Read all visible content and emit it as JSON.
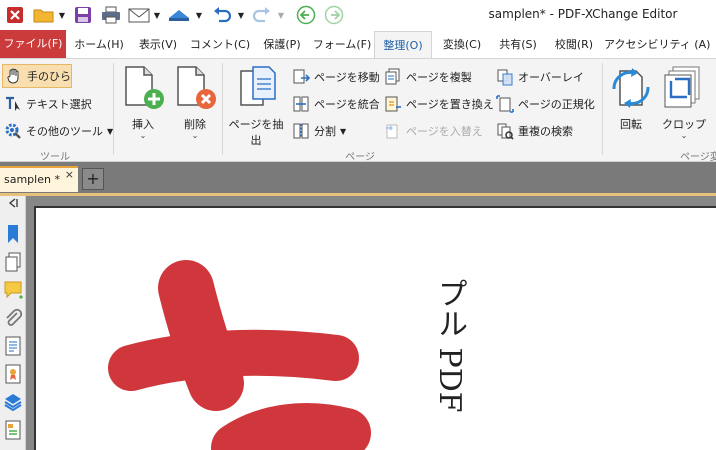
{
  "window": {
    "title": "samplen* - PDF-XChange Editor"
  },
  "menu": {
    "tabs": [
      {
        "label": "ファイル(F)"
      },
      {
        "label": "ホーム(H)"
      },
      {
        "label": "表示(V)"
      },
      {
        "label": "コメント(C)"
      },
      {
        "label": "保護(P)"
      },
      {
        "label": "フォーム(F)"
      },
      {
        "label": "整理(O)"
      },
      {
        "label": "変換(C)"
      },
      {
        "label": "共有(S)"
      },
      {
        "label": "校閲(R)"
      },
      {
        "label": "アクセシビリティ (A)"
      }
    ],
    "active": "整理(O)"
  },
  "ribbon": {
    "tools": {
      "hand": "手のひら",
      "text_select": "テキスト選択",
      "other_tools": "その他のツール",
      "group_label": "ツール"
    },
    "pages": {
      "insert": "挿入",
      "delete": "削除",
      "extract": "ページを抽出",
      "move": "ページを移動",
      "merge": "ページを統合",
      "split": "分割",
      "duplicate": "ページを複製",
      "replace": "ページを置き換え",
      "swap": "ページを入替え",
      "overlay": "オーバーレイ",
      "normalize": "ページの正規化",
      "dup_search": "重複の検索",
      "group_label": "ページ"
    },
    "transform": {
      "rotate": "回転",
      "crop": "クロップ",
      "group_label": "ページ変"
    }
  },
  "document": {
    "tab_label": "samplen *",
    "close_glyph": "×",
    "new_tab_glyph": "+",
    "vertical_text": "プル PDF"
  },
  "colors": {
    "file_tab": "#cc3b3b",
    "accent": "#1e5fa8",
    "active_doc_tab": "#e8a43a",
    "brush_red": "#d0373d"
  }
}
